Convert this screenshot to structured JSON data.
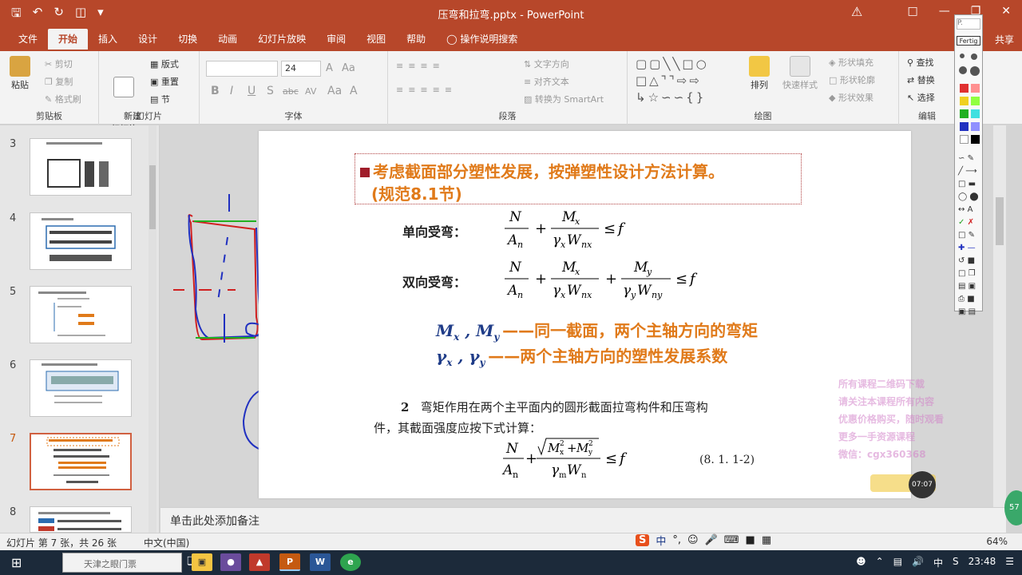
{
  "window": {
    "title": "压弯和拉弯.pptx - PowerPoint",
    "share_label": "共享"
  },
  "tabs": [
    {
      "label": "文件"
    },
    {
      "label": "开始"
    },
    {
      "label": "插入"
    },
    {
      "label": "设计"
    },
    {
      "label": "切换"
    },
    {
      "label": "动画"
    },
    {
      "label": "幻灯片放映"
    },
    {
      "label": "审阅"
    },
    {
      "label": "视图"
    },
    {
      "label": "帮助"
    },
    {
      "label": "操作说明搜索"
    }
  ],
  "ribbon": {
    "clipboard": {
      "label": "剪贴板",
      "paste": "粘贴",
      "cut": "剪切",
      "copy": "复制",
      "format_painter": "格式刷"
    },
    "slides": {
      "label": "幻灯片",
      "new_slide": "新建\n幻灯片",
      "layout": "版式",
      "reset": "重置",
      "section": "节"
    },
    "font": {
      "label": "字体",
      "size": "24",
      "bold": "B",
      "italic": "I",
      "underline": "U",
      "strike": "S",
      "abc": "abc",
      "av": "AV",
      "aa": "Aa",
      "a": "A"
    },
    "paragraph": {
      "label": "段落",
      "text_direction": "文字方向",
      "align_text": "对齐文本",
      "convert_smartart": "转换为 SmartArt"
    },
    "drawing": {
      "label": "绘图",
      "arrange": "排列",
      "quick_styles": "快速样式",
      "shape_fill": "形状填充",
      "shape_outline": "形状轮廓",
      "shape_effects": "形状效果"
    },
    "editing": {
      "label": "编辑",
      "find": "查找",
      "replace": "替换",
      "select": "选择"
    }
  },
  "slides_panel": {
    "items": [
      {
        "num": "3"
      },
      {
        "num": "4"
      },
      {
        "num": "5"
      },
      {
        "num": "6"
      },
      {
        "num": "7"
      },
      {
        "num": "8"
      }
    ],
    "active_num": "7"
  },
  "slide": {
    "heading_line1": "考虑截面部分塑性发展，按弹塑性设计方法计算。",
    "heading_line2": "(规范8.1节)",
    "uniaxial_label": "单向受弯：",
    "biaxial_label": "双向受弯：",
    "def1_symbol": "M",
    "def1_text": "——同一截面，两个主轴方向的弯矩",
    "def2_text": "——两个主轴方向的塑性发展系数",
    "para_number": "2",
    "para_line1": "弯矩作用在两个主平面内的圆形截面拉弯构件和压弯构",
    "para_line2": "件，其截面强度应按下式计算：",
    "eq_number": "(8. 1. 1-2)"
  },
  "notes_placeholder": "单击此处添加备注",
  "status": {
    "slide_info": "幻灯片 第 7 张，共 26 张",
    "language": "中文(中国)",
    "zoom": "64%"
  },
  "taskbar": {
    "search_placeholder": "天津之眼门票",
    "time": "23:48",
    "ime": "中"
  },
  "palette": {
    "title": "Fertig"
  },
  "webcam_time": "07:07",
  "badge": "57",
  "watermark_lines": [
    "所有课程二维码下载",
    "请关注本课程所有内容",
    "优惠价格购买，随时观看",
    "更多一手资源课程",
    "微信：cgx360368"
  ],
  "colors": {
    "accent": "#b7472a",
    "orange_text": "#e07a1a",
    "formula_blue": "#1f3c88",
    "pen_blue": "#2030c0",
    "pen_red": "#d02020",
    "pen_green": "#20b020"
  }
}
